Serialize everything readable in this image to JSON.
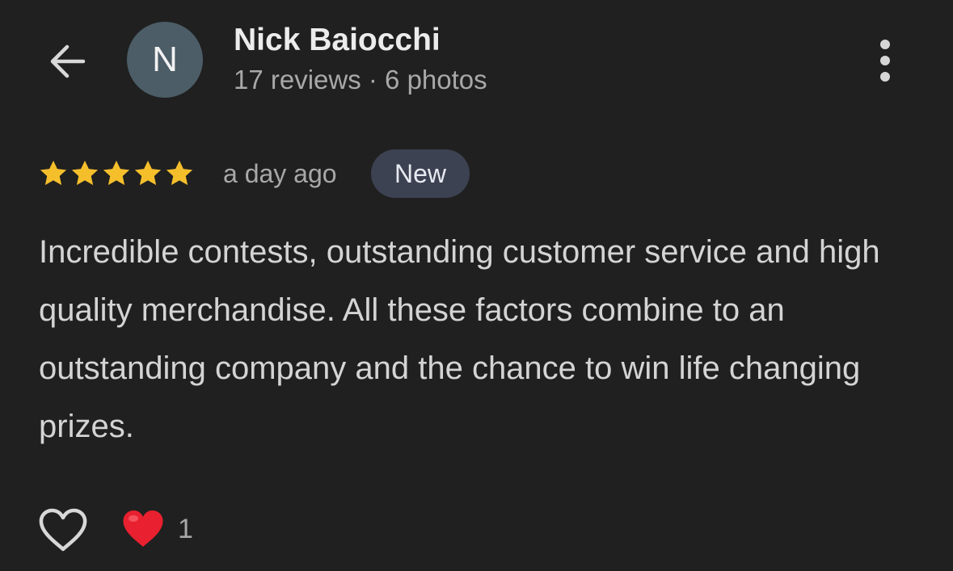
{
  "header": {
    "back_icon": "arrow-left-icon",
    "avatar_initial": "N",
    "avatar_color": "#4c5d67",
    "reviewer_name": "Nick Baiocchi",
    "reviewer_meta": "17 reviews · 6 photos",
    "more_icon": "more-vert-icon"
  },
  "review": {
    "rating": 5,
    "rating_max": 5,
    "star_color": "#f5bf2c",
    "date": "a day ago",
    "badge": "New",
    "text": "Incredible contests, outstanding customer service and high quality merchandise. All these factors combine to an outstanding company and the chance to win life changing prizes."
  },
  "reactions": {
    "like_icon": "heart-outline-icon",
    "reaction_icon": "red-heart-icon",
    "reaction_color": "#e8202f",
    "count": "1"
  }
}
